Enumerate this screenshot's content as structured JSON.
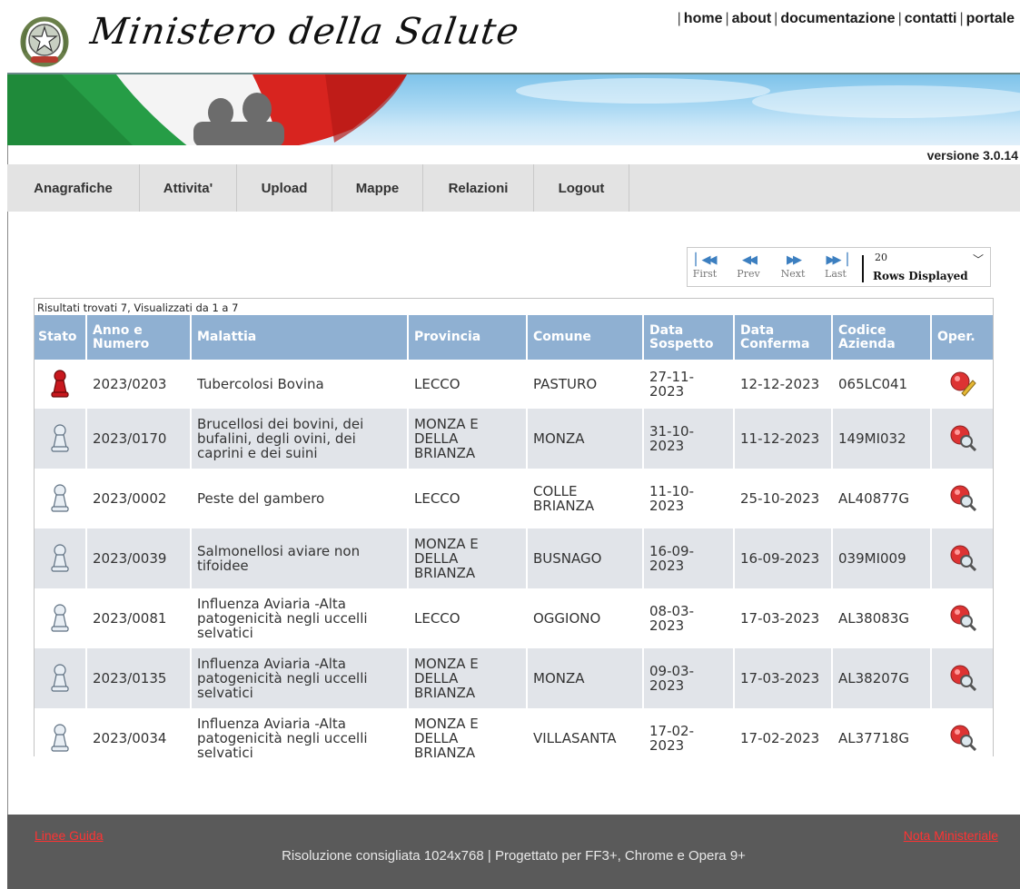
{
  "header": {
    "title": "Ministero della Salute",
    "links": [
      "home",
      "about",
      "documentazione",
      "contatti",
      "portale"
    ],
    "version": "versione 3.0.14"
  },
  "menu": [
    "Anagrafiche",
    "Attivita'",
    "Upload",
    "Mappe",
    "Relazioni",
    "Logout"
  ],
  "pager": {
    "first": "First",
    "prev": "Prev",
    "next": "Next",
    "last": "Last",
    "rows_value": "20",
    "rows_label": "Rows Displayed"
  },
  "table": {
    "info": "Risultati trovati 7, Visualizzati da 1 a 7",
    "headers": {
      "stato": "Stato",
      "anno": "Anno e Numero",
      "malattia": "Malattia",
      "provincia": "Provincia",
      "comune": "Comune",
      "sospetto": "Data Sospetto",
      "conferma": "Data Conferma",
      "azienda": "Codice Azienda",
      "oper": "Oper."
    },
    "rows": [
      {
        "stato": "red-pawn-icon",
        "anno": "2023/0203",
        "malattia": "Tubercolosi Bovina",
        "provincia": "LECCO",
        "comune": "PASTURO",
        "sospetto": "27-11-2023",
        "conferma": "12-12-2023",
        "azienda": "065LC041",
        "oper": "edit-icon"
      },
      {
        "stato": "grey-pawn-icon",
        "anno": "2023/0170",
        "malattia": "Brucellosi dei bovini, dei bufalini, degli ovini, dei caprini e dei suini",
        "provincia": "MONZA E DELLA BRIANZA",
        "comune": "MONZA",
        "sospetto": "31-10-2023",
        "conferma": "11-12-2023",
        "azienda": "149MI032",
        "oper": "view-icon"
      },
      {
        "stato": "grey-pawn-icon",
        "anno": "2023/0002",
        "malattia": "Peste del gambero",
        "provincia": "LECCO",
        "comune": "COLLE BRIANZA",
        "sospetto": "11-10-2023",
        "conferma": "25-10-2023",
        "azienda": "AL40877G",
        "oper": "view-icon"
      },
      {
        "stato": "grey-pawn-icon",
        "anno": "2023/0039",
        "malattia": "Salmonellosi aviare non tifoidee",
        "provincia": "MONZA E DELLA BRIANZA",
        "comune": "BUSNAGO",
        "sospetto": "16-09-2023",
        "conferma": "16-09-2023",
        "azienda": "039MI009",
        "oper": "view-icon"
      },
      {
        "stato": "grey-pawn-icon",
        "anno": "2023/0081",
        "malattia": "Influenza Aviaria -Alta patogenicità negli uccelli selvatici",
        "provincia": "LECCO",
        "comune": "OGGIONO",
        "sospetto": "08-03-2023",
        "conferma": "17-03-2023",
        "azienda": "AL38083G",
        "oper": "view-icon"
      },
      {
        "stato": "grey-pawn-icon",
        "anno": "2023/0135",
        "malattia": "Influenza Aviaria -Alta patogenicità negli uccelli selvatici",
        "provincia": "MONZA E DELLA BRIANZA",
        "comune": "MONZA",
        "sospetto": "09-03-2023",
        "conferma": "17-03-2023",
        "azienda": "AL38207G",
        "oper": "view-icon"
      },
      {
        "stato": "grey-pawn-icon",
        "anno": "2023/0034",
        "malattia": "Influenza Aviaria -Alta patogenicità negli uccelli selvatici",
        "provincia": "MONZA E DELLA BRIANZA",
        "comune": "VILLASANTA",
        "sospetto": "17-02-2023",
        "conferma": "17-02-2023",
        "azienda": "AL37718G",
        "oper": "view-icon"
      }
    ]
  },
  "footer": {
    "left_link": "Linee Guida",
    "right_link": "Nota Ministeriale",
    "note": "Risoluzione consigliata 1024x768 | Progettato per FF3+, Chrome e Opera 9+"
  },
  "colors": {
    "table_header": "#8fb0d2",
    "row_alt": "#e1e4e9",
    "menu_bg": "#e3e3e3",
    "footer_bg": "#5a5a5a",
    "footer_link": "#ff3333"
  }
}
